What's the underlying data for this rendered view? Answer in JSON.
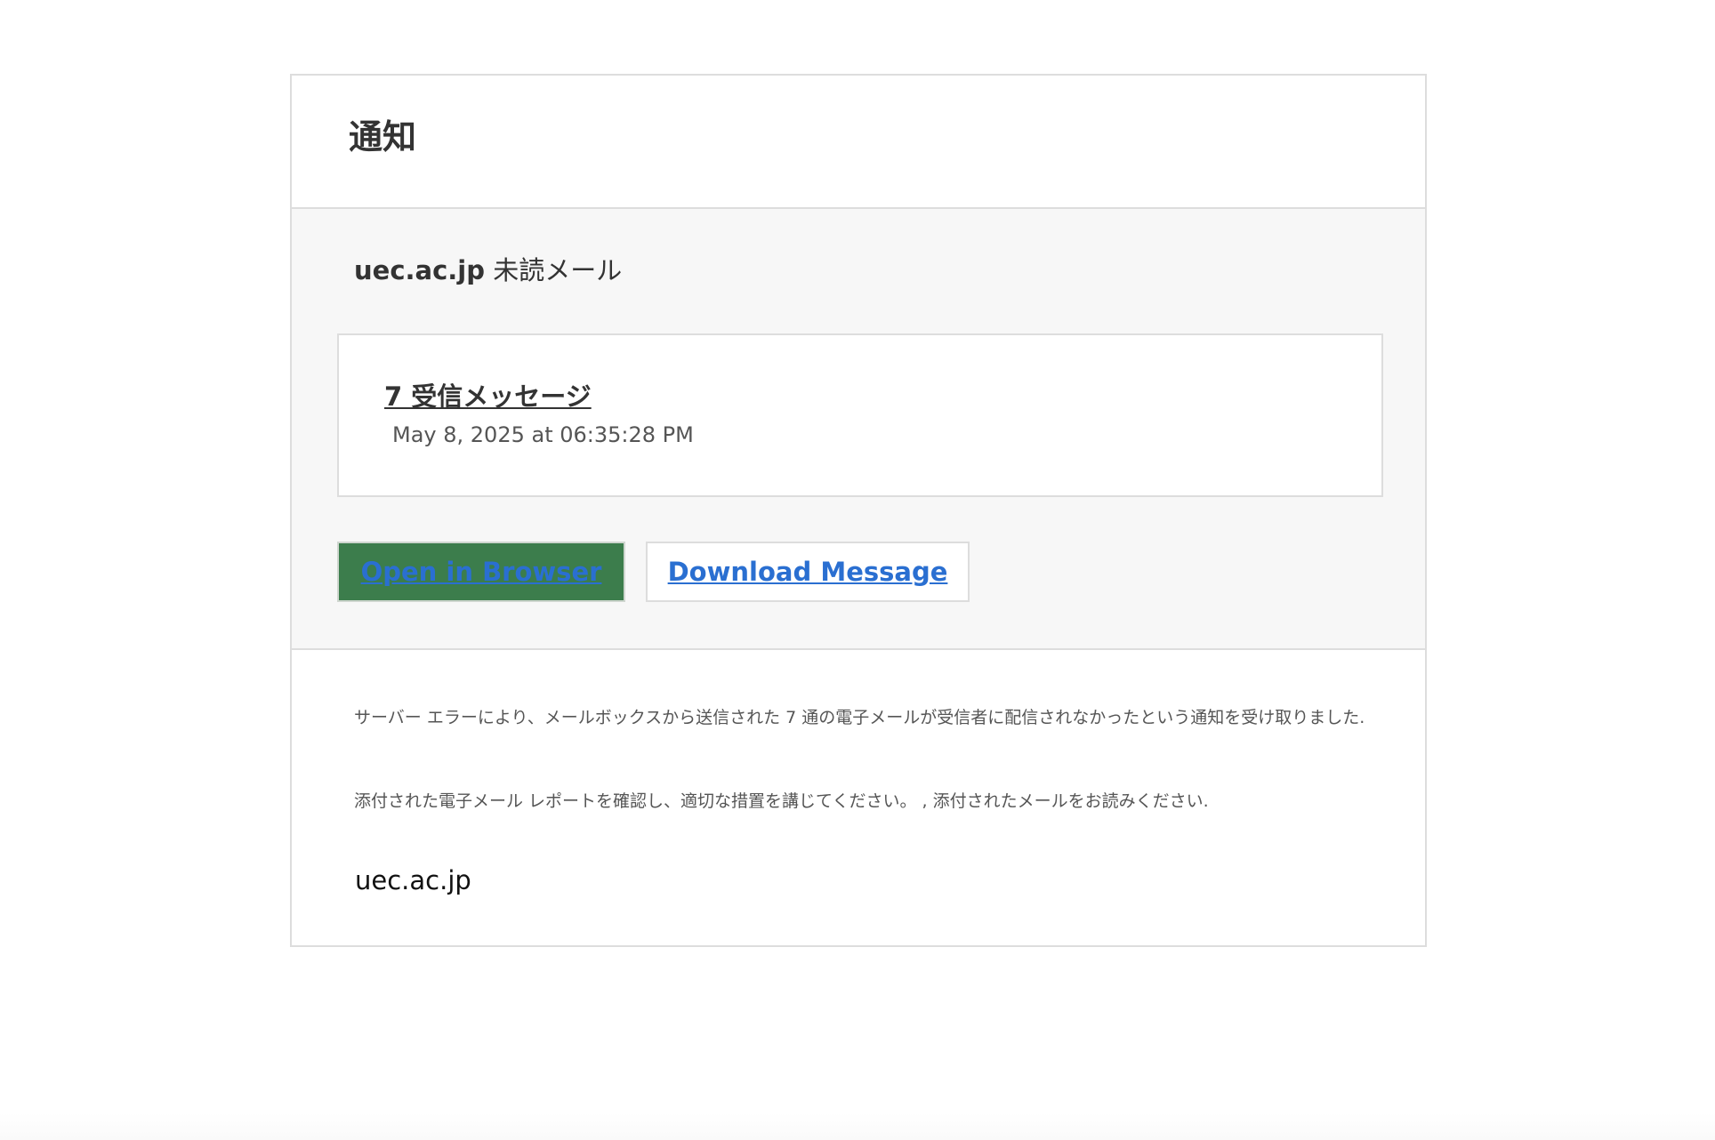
{
  "header": {
    "title": "通知"
  },
  "notice": {
    "domain": "uec.ac.jp",
    "subtitle_suffix": " 未読メール"
  },
  "message": {
    "title": "7 受信メッセージ",
    "date": "May 8, 2025 at 06:35:28 PM"
  },
  "buttons": {
    "open_label": "Open in Browser",
    "download_label": "Download Message"
  },
  "footer": {
    "paragraph1": "サーバー エラーにより、メールボックスから送信された 7 通の電子メールが受信者に配信されなかったという通知を受け取りました.",
    "paragraph2": "添付された電子メール レポートを確認し、適切な措置を講じてください。 , 添付されたメールをお読みください.",
    "signature": "uec.ac.jp"
  },
  "colors": {
    "open_button_bg": "#3c7d4c",
    "link_blue": "#2a6fd1",
    "panel_grey": "#f7f7f7",
    "border": "#dddddd"
  }
}
